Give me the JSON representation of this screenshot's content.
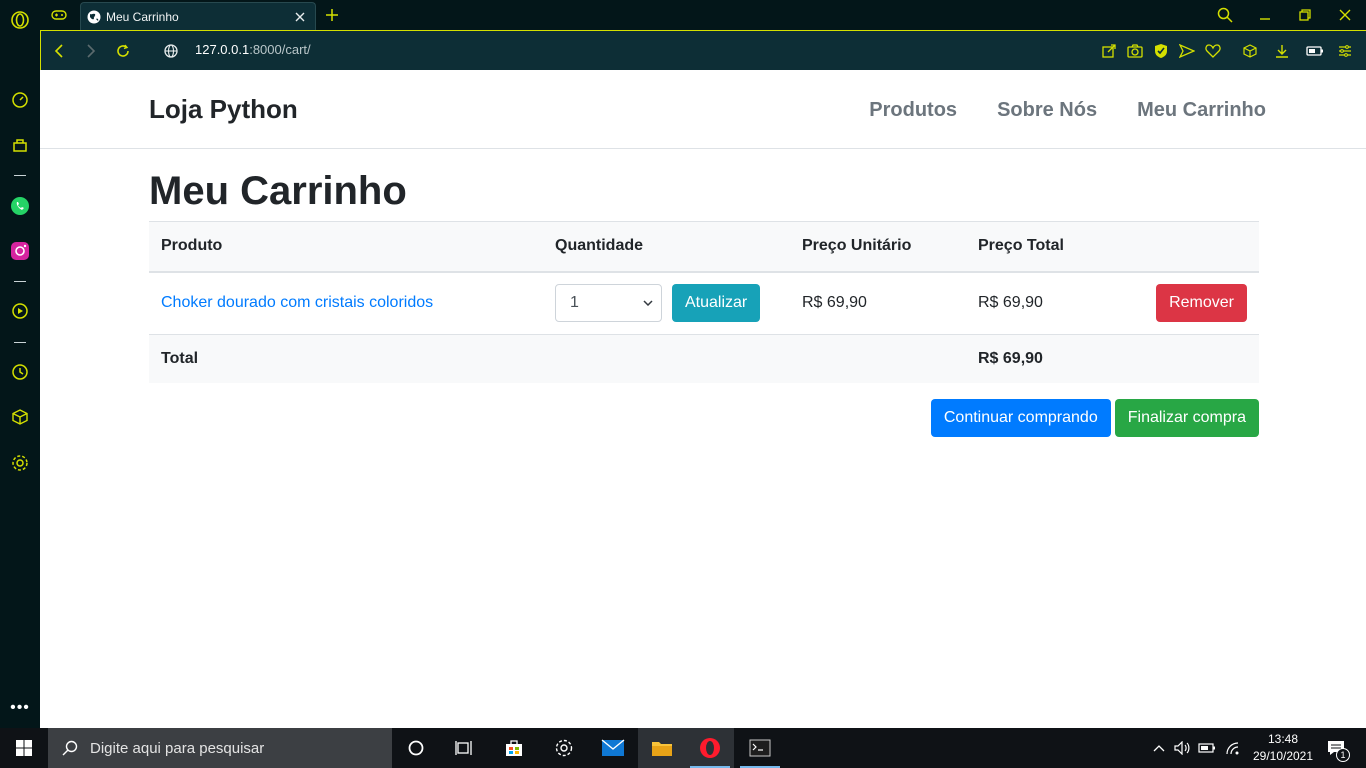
{
  "browser": {
    "tab_title": "Meu Carrinho",
    "url_host": "127.0.0.1",
    "url_path": ":8000/cart/"
  },
  "site": {
    "brand": "Loja Python",
    "nav": [
      "Produtos",
      "Sobre Nós",
      "Meu Carrinho"
    ]
  },
  "cart": {
    "title": "Meu Carrinho",
    "headers": [
      "Produto",
      "Quantidade",
      "Preço Unitário",
      "Preço Total"
    ],
    "items": [
      {
        "product": "Choker dourado com cristais coloridos",
        "quantity": "1",
        "unit_price": "R$ 69,90",
        "total_price": "R$ 69,90",
        "update_label": "Atualizar",
        "remove_label": "Remover"
      }
    ],
    "total_label": "Total",
    "total_value": "R$ 69,90",
    "continue_label": "Continuar comprando",
    "checkout_label": "Finalizar compra"
  },
  "taskbar": {
    "search_placeholder": "Digite aqui para pesquisar",
    "time": "13:48",
    "date": "29/10/2021",
    "notification_count": "1"
  },
  "colors": {
    "accent": "#d4e000",
    "primary": "#007bff",
    "info": "#17a2b8",
    "danger": "#dc3545",
    "success": "#28a745"
  }
}
